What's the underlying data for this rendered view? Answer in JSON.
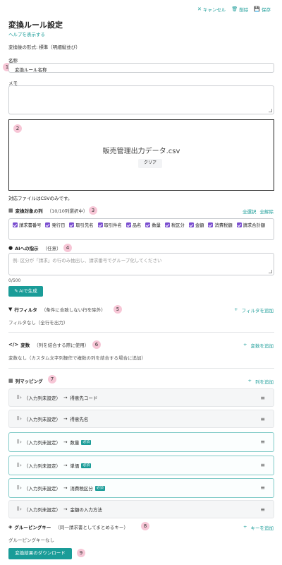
{
  "top_actions": {
    "cancel": "キャンセル",
    "delete": "削除",
    "save": "保存"
  },
  "title": "変換ルール設定",
  "help_link": "ヘルプを表示する",
  "output_format": "変換後の形式: 標準（明細縦並び）",
  "name_field": {
    "label": "名称",
    "value": "変換ルール名称"
  },
  "memo_field": {
    "label": "メモ",
    "value": ""
  },
  "dropzone": {
    "file_name": "販売管理出力データ.csv",
    "clear_label": "クリア"
  },
  "csv_note": "対応ファイルはCSVのみです。",
  "target_columns": {
    "title": "変換対象の列",
    "count": "（10/10列選択中）",
    "select_all": "全選択",
    "deselect_all": "全解除",
    "items": [
      "請求書番号",
      "発行日",
      "取引先名",
      "取引件名",
      "品名",
      "数量",
      "税区分",
      "金額",
      "消費税額",
      "請求合計額"
    ]
  },
  "ai_instruction": {
    "title": "AIへの指示",
    "optional": "（任意）",
    "placeholder": "例: 区分が「請求」の行のみ抽出し、請求番号でグループ化してください",
    "counter": "0/500",
    "generate_label": "AIで生成"
  },
  "row_filter": {
    "title": "行フィルタ",
    "sub": "（条件に合致しない行を除外）",
    "add_label": "フィルタを追加",
    "empty": "フィルタなし（全行を出力）"
  },
  "variables": {
    "title": "変数",
    "sub": "（列を結合する際に使用）",
    "add_label": "変数を追加",
    "empty": "変数なし（カスタム文字列操作で複数の列を結合する場合に追加）"
  },
  "column_mapping": {
    "title": "列マッピング",
    "add_label": "列を追加",
    "rows": [
      {
        "source": "（入力列未設定）",
        "arrow": "→",
        "target": "得意先コード",
        "required": ""
      },
      {
        "source": "（入力列未設定）",
        "arrow": "→",
        "target": "得意先名",
        "required": ""
      },
      {
        "source": "（入力列未設定）",
        "arrow": "→",
        "target": "数量",
        "required": "必須"
      },
      {
        "source": "（入力列未設定）",
        "arrow": "→",
        "target": "単価",
        "required": "必須"
      },
      {
        "source": "（入力列未設定）",
        "arrow": "→",
        "target": "消費税区分",
        "required": "必須"
      },
      {
        "source": "（入力列未設定）",
        "arrow": "→",
        "target": "金額の入力方法",
        "required": ""
      }
    ]
  },
  "grouping": {
    "title": "グルーピングキー",
    "sub": "（同一請求書としてまとめるキー）",
    "add_label": "キーを追加",
    "empty": "グルーピングキーなし"
  },
  "download_label": "変換結果のダウンロード",
  "markers": [
    "1",
    "2",
    "3",
    "4",
    "5",
    "6",
    "7",
    "8",
    "9"
  ],
  "colors": {
    "accent": "#1a9c98",
    "checkbox": "#7b4fd0",
    "marker": "#f7c6d6"
  }
}
